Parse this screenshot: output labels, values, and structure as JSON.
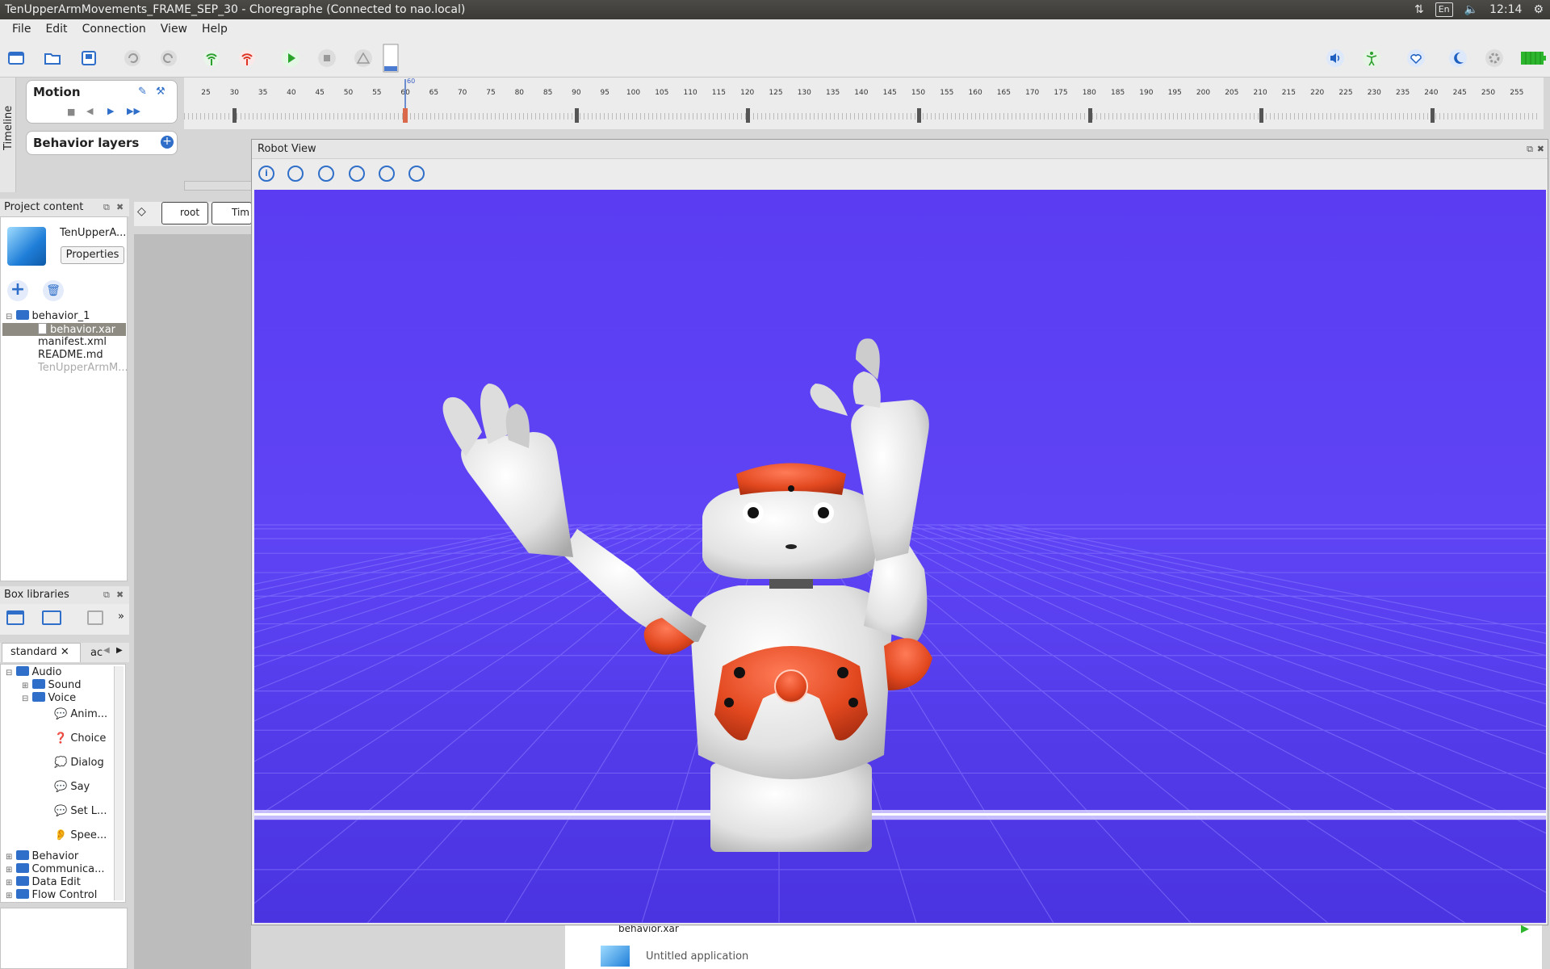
{
  "window": {
    "title": "TenUpperArmMovements_FRAME_SEP_30 - Choregraphe (Connected to nao.local)"
  },
  "indicators": {
    "lang": "En",
    "time": "12:14"
  },
  "menu": [
    "File",
    "Edit",
    "Connection",
    "View",
    "Help"
  ],
  "timeline": {
    "tab_label": "Timeline",
    "motion_label": "Motion",
    "behavior_layers_label": "Behavior layers",
    "ticks": [
      "25",
      "30",
      "35",
      "40",
      "45",
      "50",
      "55",
      "60",
      "65",
      "70",
      "75",
      "80",
      "85",
      "90",
      "95",
      "100",
      "105",
      "110",
      "115",
      "120",
      "125",
      "130",
      "135",
      "140",
      "145",
      "150",
      "155",
      "160",
      "165",
      "170",
      "175",
      "180",
      "185",
      "190",
      "195",
      "200",
      "205",
      "210",
      "215",
      "220",
      "225",
      "230",
      "235",
      "240",
      "245",
      "250",
      "255"
    ],
    "current_frame": "60"
  },
  "flow": {
    "root_label": "root",
    "timeline_label": "Tim"
  },
  "project": {
    "header": "Project content",
    "name": "TenUpperA...",
    "properties_button": "Properties",
    "items": [
      "behavior_1",
      "behavior.xar",
      "manifest.xml",
      "README.md",
      "TenUpperArmM..."
    ]
  },
  "box_libraries": {
    "header": "Box libraries",
    "tab_standard": "standard",
    "tab_other": "ac",
    "items": [
      "Audio",
      "Sound",
      "Voice",
      "Anim...",
      "Choice",
      "Dialog",
      "Say",
      "Set L...",
      "Spee...",
      "Behavior",
      "Communica...",
      "Data Edit",
      "Flow Control"
    ]
  },
  "robot_view": {
    "title": "Robot View"
  },
  "bottom": {
    "file_label": "behavior.xar",
    "app_label": "Untitled application"
  },
  "colors": {
    "scene": "#5a3ff0",
    "accent_orange": "#e2481f",
    "robot_white": "#e8e8e8"
  }
}
